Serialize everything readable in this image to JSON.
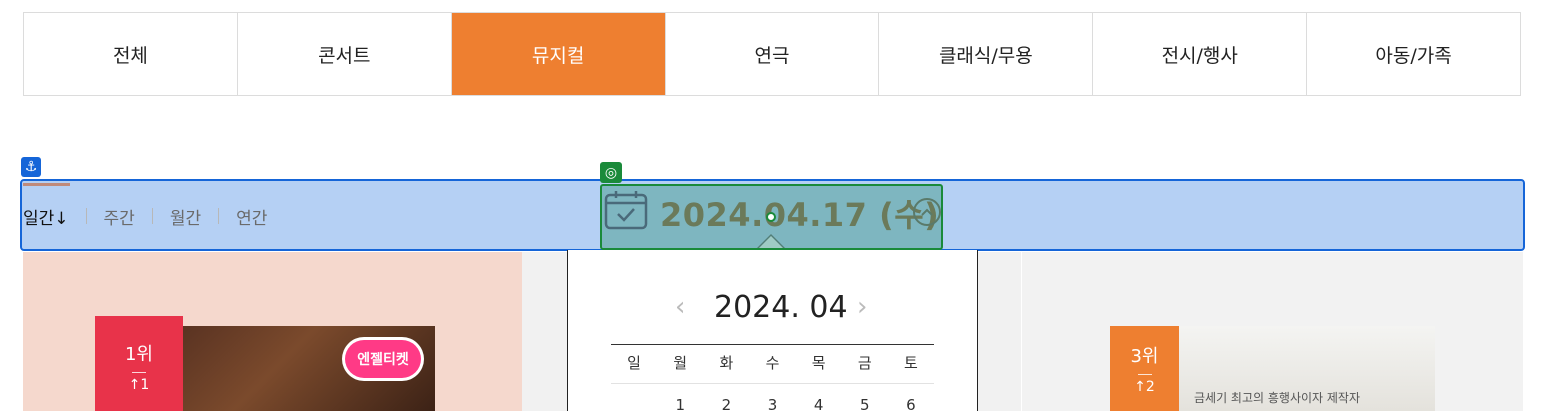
{
  "genre_tabs": [
    "전체",
    "콘서트",
    "뮤지컬",
    "연극",
    "클래식/무용",
    "전시/행사",
    "아동/가족"
  ],
  "active_genre": "뮤지컬",
  "period_tabs": {
    "daily": "일간↓",
    "weekly": "주간",
    "monthly": "월간",
    "yearly": "연간"
  },
  "date_picker": {
    "selected_date": "2024.04.17 (수)"
  },
  "calendar": {
    "month_label": "2024. 04",
    "weekdays": [
      "일",
      "월",
      "화",
      "수",
      "목",
      "금",
      "토"
    ],
    "first_week": [
      "",
      "1",
      "2",
      "3",
      "4",
      "5",
      "6"
    ]
  },
  "rankings": [
    {
      "rank": "1위",
      "change": "↑1",
      "badge_color": "#e8334a",
      "promo_badge": "엔젤티켓"
    },
    {
      "rank": "3위",
      "change": "↑2",
      "badge_color": "#ee7f30",
      "poster_caption": "금세기 최고의 흥행사이자 제작자"
    }
  ],
  "colors": {
    "accent": "#ee7f30",
    "rank1": "#e8334a"
  }
}
